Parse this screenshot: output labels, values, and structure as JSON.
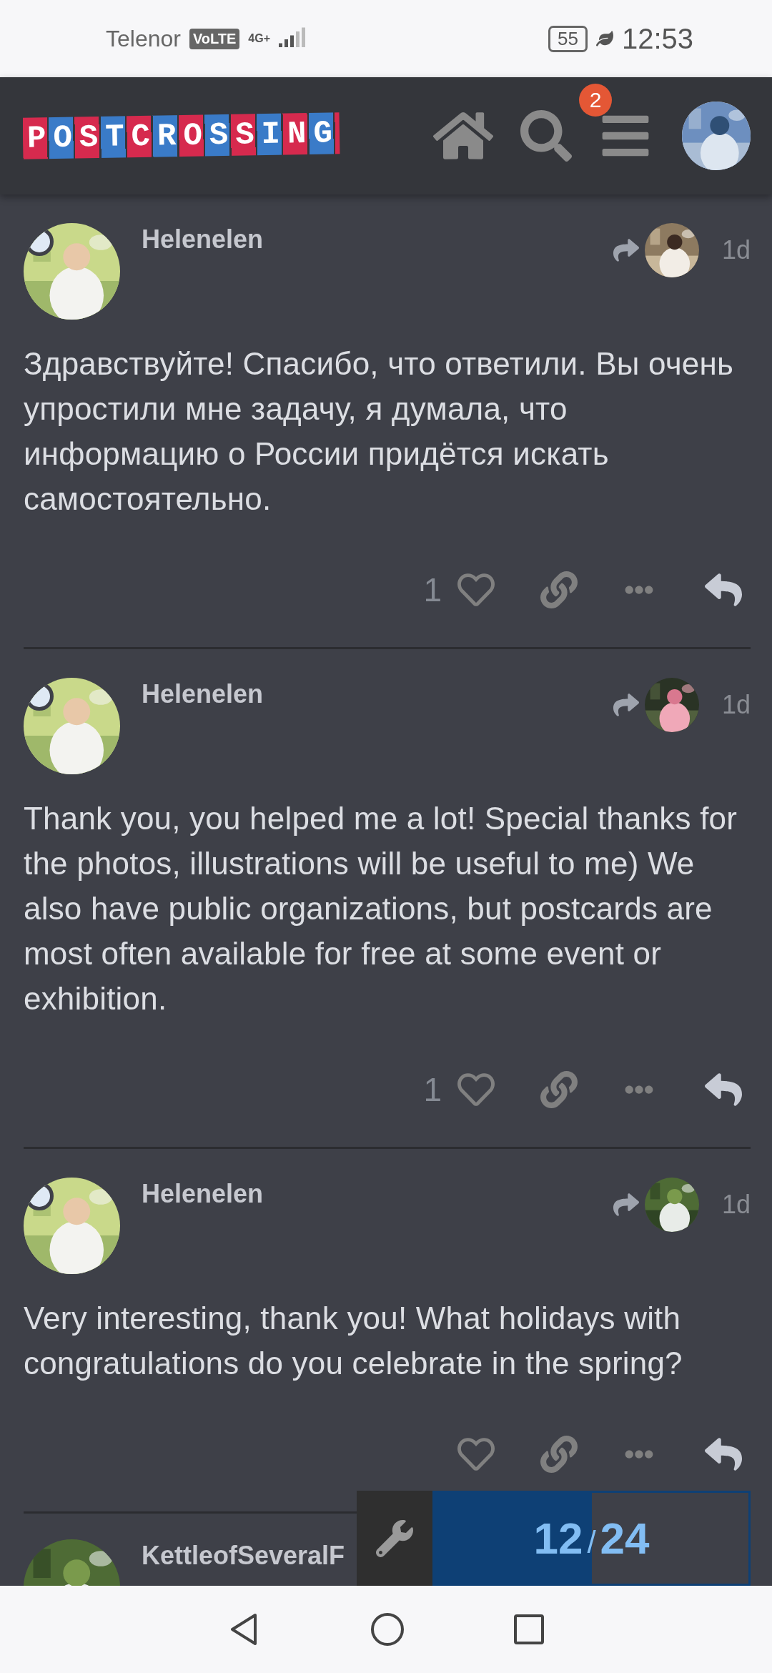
{
  "status_bar": {
    "carrier": "Telenor",
    "volte": "VoLTE",
    "network": "4G+",
    "battery": "55",
    "time": "12:53"
  },
  "header": {
    "logo": "POSTCROSSING",
    "notification_count": "2"
  },
  "posts": [
    {
      "author": "Helenelen",
      "age": "1d",
      "body": "Здравствуйте! Спасибо, что ответили. Вы очень упростили мне задачу, я думала, что информацию о России придётся искать самостоятельно.",
      "likes": "1"
    },
    {
      "author": "Helenelen",
      "age": "1d",
      "body": "Thank you, you helped me a lot! Special thanks for the photos, illustrations will be useful to me) We also have public organizations, but postcards are most often available for free at some event or exhibition.",
      "likes": "1"
    },
    {
      "author": "Helenelen",
      "age": "1d",
      "body": "Very interesting, thank you! What holidays with congratulations do you celebrate in the spring?"
    }
  ],
  "partial_post": {
    "author": "KettleofSeveralF"
  },
  "progress": {
    "current": "12",
    "separator": "/",
    "total": "24",
    "level": 0.5
  }
}
